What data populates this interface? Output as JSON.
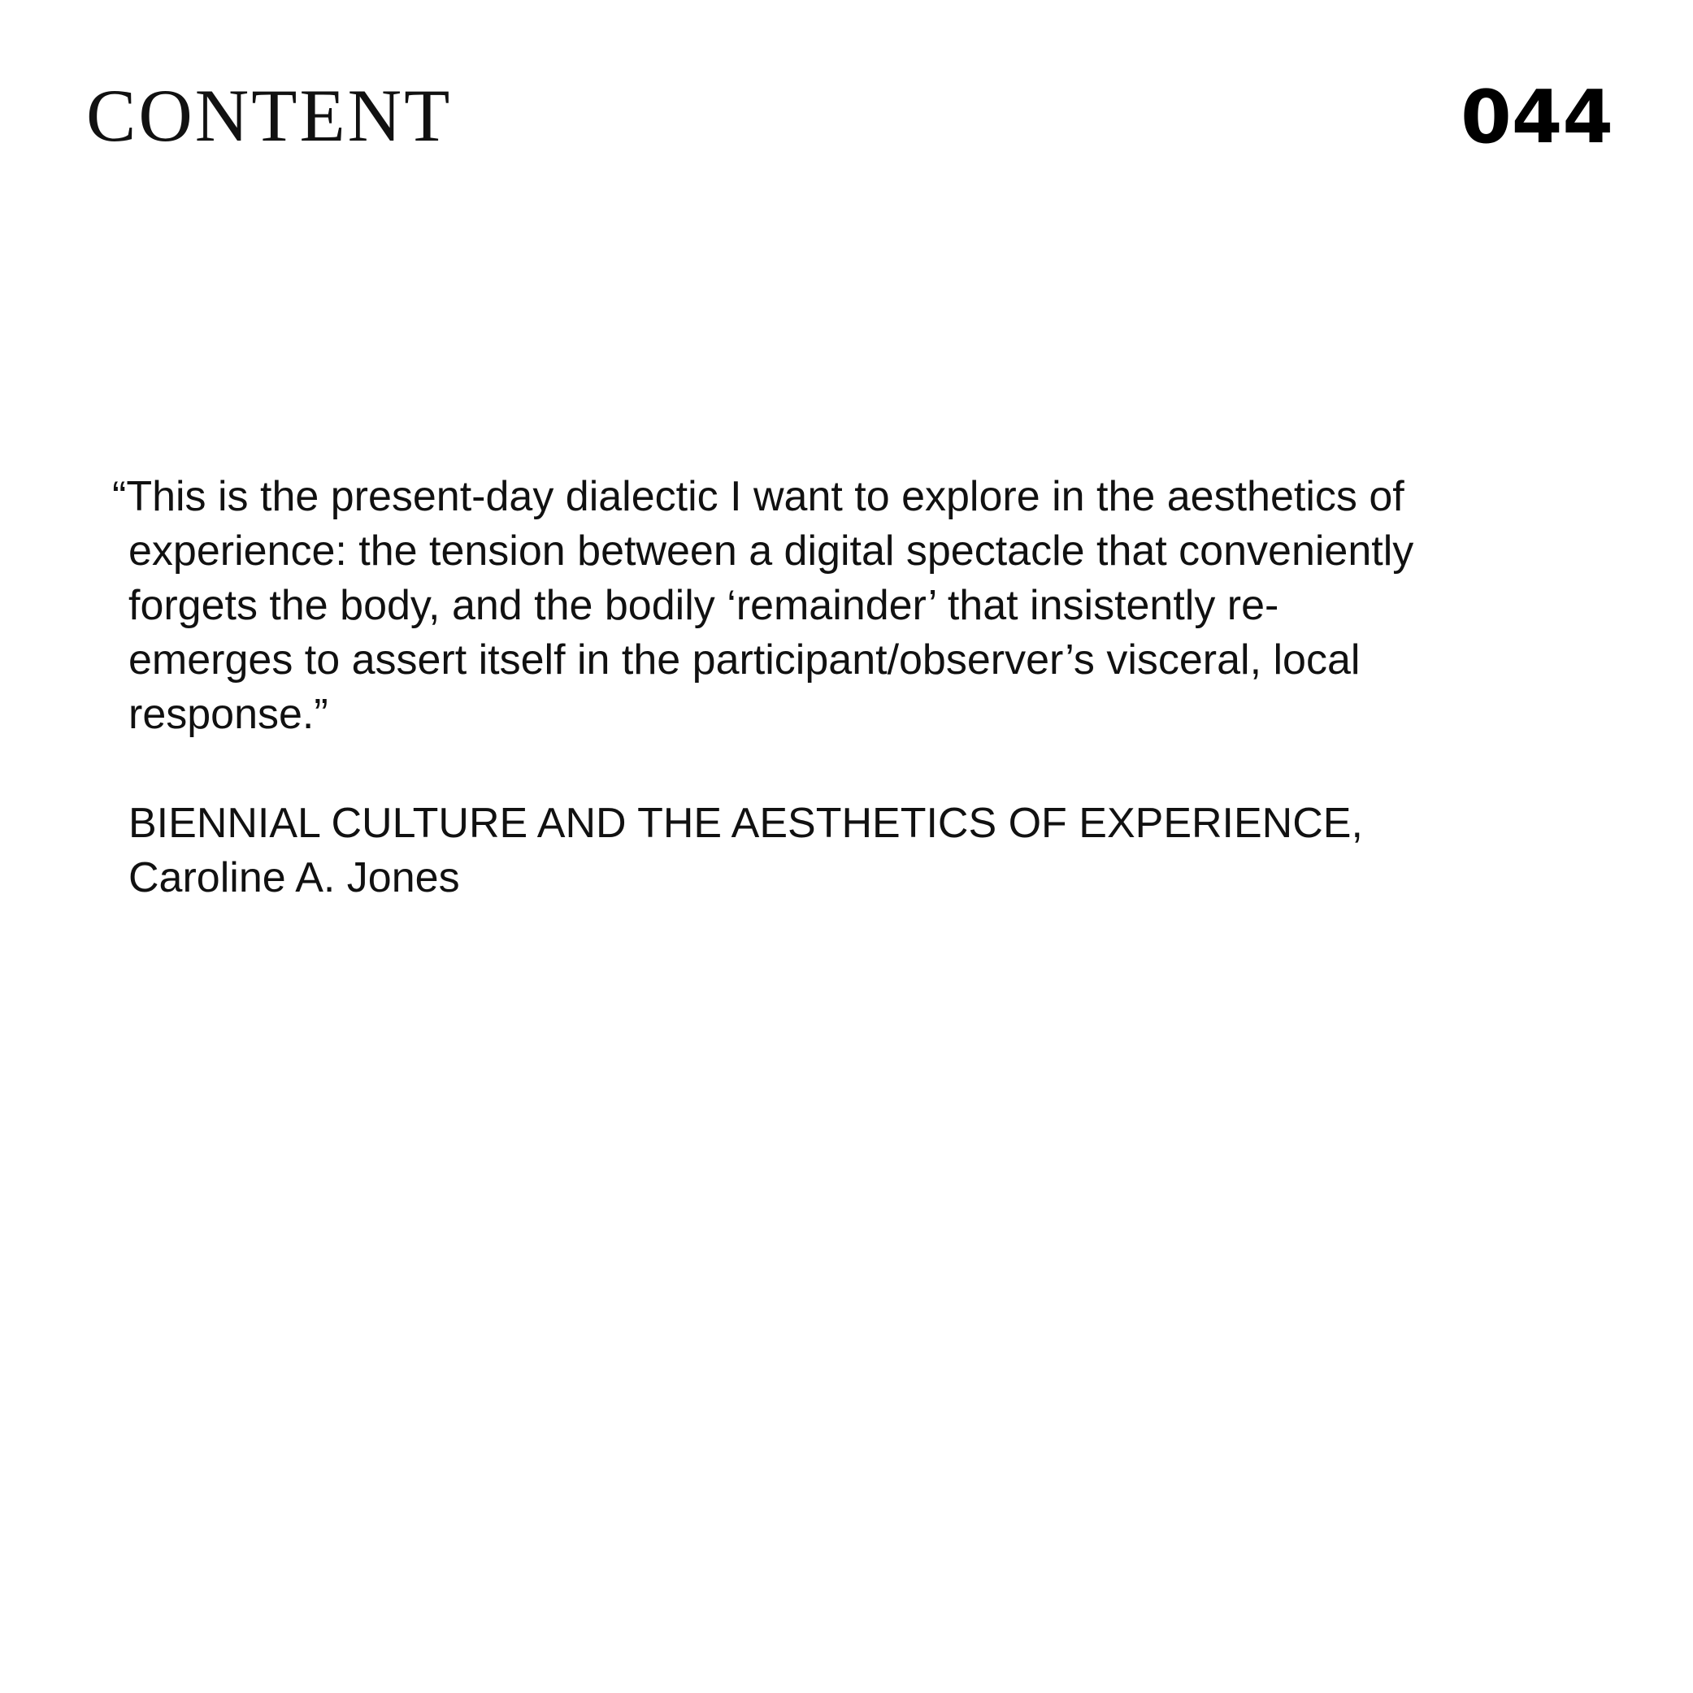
{
  "header": {
    "masthead": "CONTENT",
    "page_number": "044"
  },
  "quote": {
    "lines": [
      "“This is the present-day dialectic I want to explore in the aesthetics of",
      "experience: the tension between a digital spectacle that conveniently",
      "forgets the body, and the bodily ‘remainder’ that insistently re-",
      "emerges to assert itself in the participant/observer’s visceral, local",
      "response.”"
    ]
  },
  "source": {
    "title": "BIENNIAL CULTURE AND THE AESTHETICS OF EXPERIENCE,",
    "author": "Caroline A. Jones"
  }
}
